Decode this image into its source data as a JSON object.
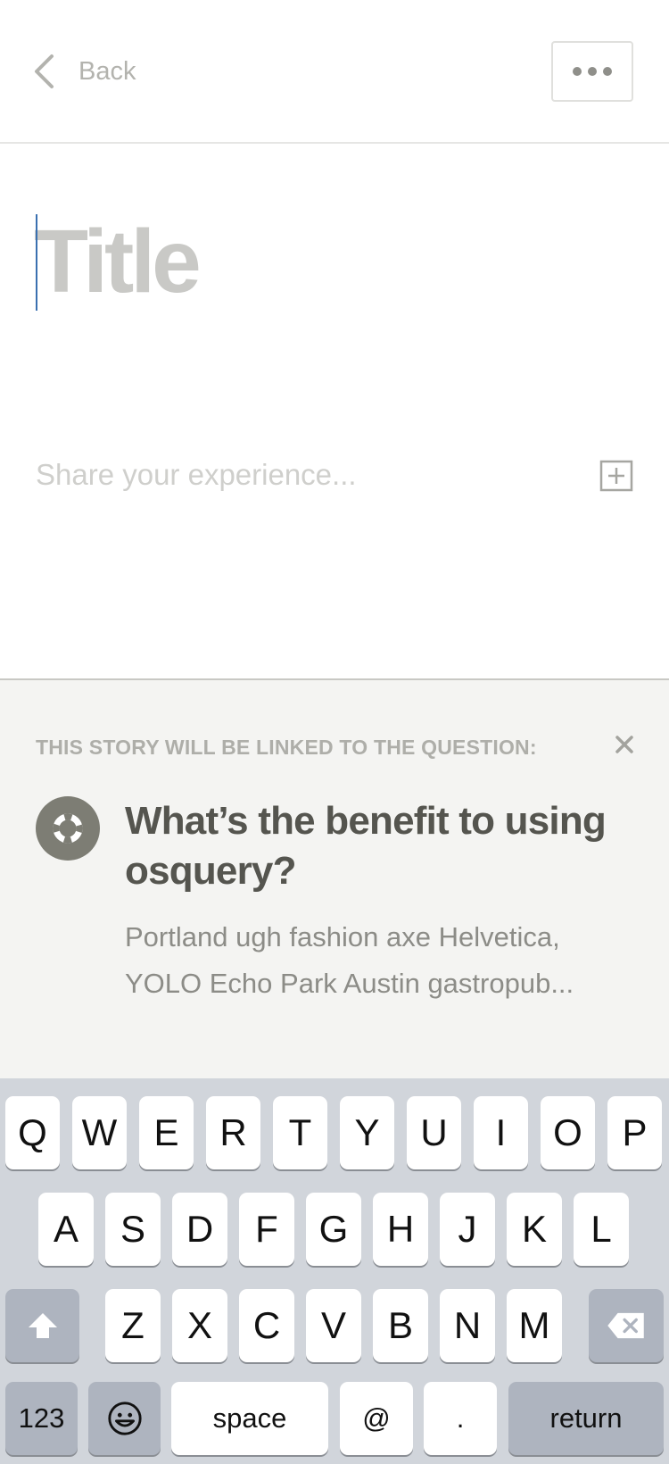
{
  "header": {
    "back_label": "Back",
    "back_icon": "chevron-left-icon",
    "more_icon": "ellipsis-icon"
  },
  "editor": {
    "title_placeholder": "Title",
    "title_value": "",
    "body_placeholder": "Share your experience...",
    "body_value": "",
    "add_icon": "plus-square-icon"
  },
  "linked_question": {
    "label": "THIS STORY WILL BE LINKED TO THE QUESTION:",
    "close_icon": "close-icon",
    "question_icon": "lifebuoy-icon",
    "title": "What’s the benefit to using osquery?",
    "description": "Portland ugh fashion axe Helvetica, YOLO Echo Park Austin gastropub..."
  },
  "keyboard": {
    "row1": [
      "Q",
      "W",
      "E",
      "R",
      "T",
      "Y",
      "U",
      "I",
      "O",
      "P"
    ],
    "row2": [
      "A",
      "S",
      "D",
      "F",
      "G",
      "H",
      "J",
      "K",
      "L"
    ],
    "row3": [
      "Z",
      "X",
      "C",
      "V",
      "B",
      "N",
      "M"
    ],
    "numbers_label": "123",
    "space_label": "space",
    "at_label": "@",
    "period_label": ".",
    "return_label": "return",
    "shift_icon": "shift-icon",
    "delete_icon": "backspace-icon",
    "emoji_icon": "emoji-icon"
  },
  "colors": {
    "caret": "#3a70b0",
    "panel_bg": "#f4f4f2",
    "keyboard_bg": "#d1d5db"
  }
}
